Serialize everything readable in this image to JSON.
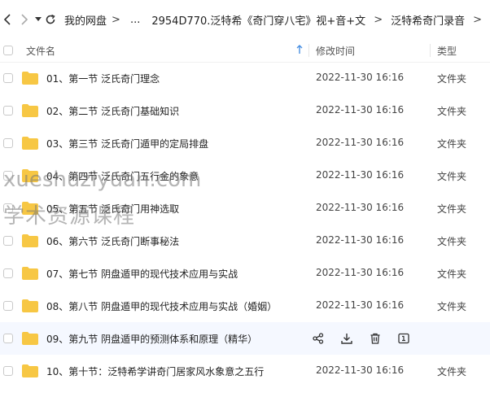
{
  "breadcrumb": {
    "items": [
      "我的网盘",
      "...",
      "2954D770.泛特希《奇门穿八宅》视+音+文",
      "泛特希奇门录音"
    ],
    "separator": ">"
  },
  "table": {
    "columns": {
      "name": "文件名",
      "time": "修改时间",
      "type": "类型"
    },
    "rows": [
      {
        "name": "01、第一节 泛氏奇门理念",
        "time": "2022-11-30 16:16",
        "type": "文件夹"
      },
      {
        "name": "02、第二节 泛氏奇门基础知识",
        "time": "2022-11-30 16:16",
        "type": "文件夹"
      },
      {
        "name": "03、第三节 泛氏奇门遁甲的定局排盘",
        "time": "2022-11-30 16:16",
        "type": "文件夹"
      },
      {
        "name": "04、第四节 泛氏奇门五行金的象意",
        "time": "2022-11-30 16:16",
        "type": "文件夹"
      },
      {
        "name": "05、第五节 泛氏奇门用神选取",
        "time": "2022-11-30 16:16",
        "type": "文件夹"
      },
      {
        "name": "06、第六节 泛氏奇门断事秘法",
        "time": "2022-11-30 16:16",
        "type": "文件夹"
      },
      {
        "name": "07、第七节  阴盘遁甲的现代技术应用与实战",
        "time": "2022-11-30 16:16",
        "type": "文件夹"
      },
      {
        "name": "08、第八节  阴盘遁甲的现代技术应用与实战（婚姻）",
        "time": "2022-11-30 16:16",
        "type": "文件夹"
      },
      {
        "name": "09、第九节  阴盘遁甲的预测体系和原理（精华）",
        "time": "",
        "type": ""
      },
      {
        "name": "10、第十节：泛特希学讲奇门居家风水象意之五行",
        "time": "2022-11-30 16:16",
        "type": "文件夹"
      }
    ]
  },
  "watermark": {
    "line1": "xueshuziyuan.com",
    "line2": "学术资源课程"
  },
  "colors": {
    "folder": "#F7C744",
    "accent": "#4A90E2",
    "hover_row": "#F5F8FF"
  }
}
